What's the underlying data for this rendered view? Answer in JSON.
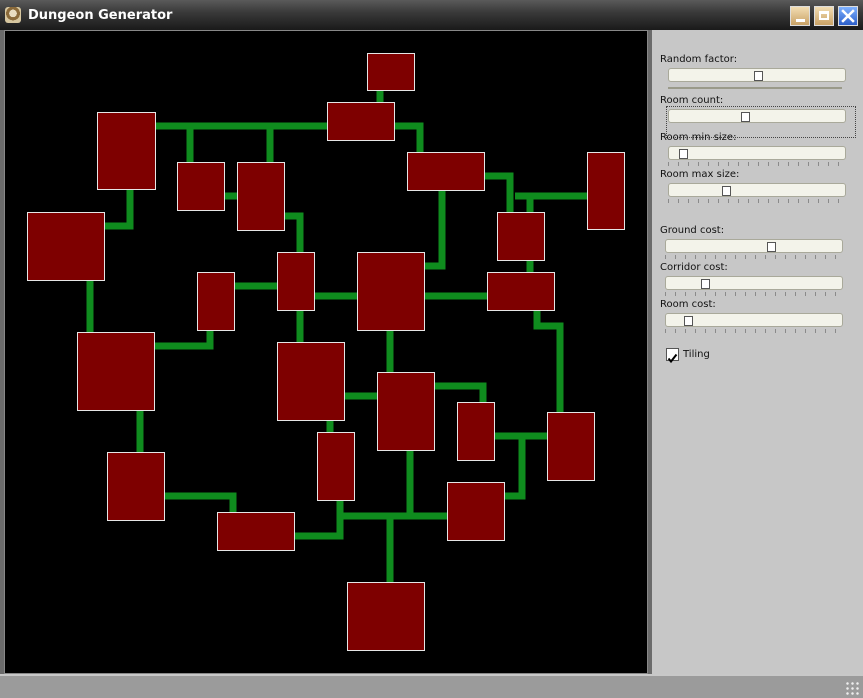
{
  "window": {
    "title": "Dungeon Generator",
    "app_icon": "dungeon-app-icon",
    "controls": {
      "minimize_icon": "minimize-icon",
      "maximize_icon": "maximize-icon",
      "close_icon": "close-icon"
    }
  },
  "panel": {
    "random_factor": {
      "label": "Random factor:",
      "value": 0.51
    },
    "room_count": {
      "label": "Room count:",
      "value": 0.43
    },
    "room_min_size": {
      "label": "Room min size:",
      "value": 0.05
    },
    "room_max_size": {
      "label": "Room max size:",
      "value": 0.31
    },
    "ground_cost": {
      "label": "Ground cost:",
      "value": 0.61
    },
    "corridor_cost": {
      "label": "Corridor cost:",
      "value": 0.2
    },
    "room_cost": {
      "label": "Room cost:",
      "value": 0.1
    },
    "tiling": {
      "label": "Tiling",
      "checked": true
    }
  },
  "colors": {
    "room": "#7e0000",
    "room_border": "#e6e6e6",
    "corridor": "#0f8c1e",
    "canvas": "#000000"
  }
}
